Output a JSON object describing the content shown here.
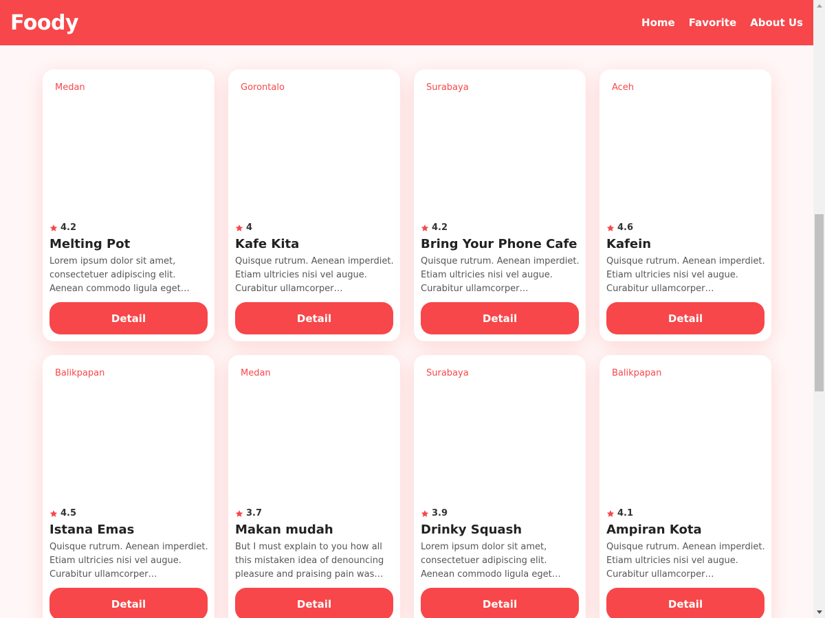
{
  "header": {
    "brand": "Foody",
    "nav": [
      {
        "label": "Home"
      },
      {
        "label": "Favorite"
      },
      {
        "label": "About Us"
      }
    ]
  },
  "theme": {
    "accent": "#f7474a"
  },
  "restaurants": [
    {
      "city": "Medan",
      "rating": "4.2",
      "name": "Melting Pot",
      "description": "Lorem ipsum dolor sit amet, consectetuer adipiscing elit. Aenean commodo ligula eget…",
      "button": "Detail"
    },
    {
      "city": "Gorontalo",
      "rating": "4",
      "name": "Kafe Kita",
      "description": "Quisque rutrum. Aenean imperdiet. Etiam ultricies nisi vel augue. Curabitur ullamcorper…",
      "button": "Detail"
    },
    {
      "city": "Surabaya",
      "rating": "4.2",
      "name": "Bring Your Phone Cafe",
      "description": "Quisque rutrum. Aenean imperdiet. Etiam ultricies nisi vel augue. Curabitur ullamcorper…",
      "button": "Detail"
    },
    {
      "city": "Aceh",
      "rating": "4.6",
      "name": "Kafein",
      "description": "Quisque rutrum. Aenean imperdiet. Etiam ultricies nisi vel augue. Curabitur ullamcorper…",
      "button": "Detail"
    },
    {
      "city": "Balikpapan",
      "rating": "4.5",
      "name": "Istana Emas",
      "description": "Quisque rutrum. Aenean imperdiet. Etiam ultricies nisi vel augue. Curabitur ullamcorper…",
      "button": "Detail"
    },
    {
      "city": "Medan",
      "rating": "3.7",
      "name": "Makan mudah",
      "description": "But I must explain to you how all this mistaken idea of denouncing pleasure and praising pain was…",
      "button": "Detail"
    },
    {
      "city": "Surabaya",
      "rating": "3.9",
      "name": "Drinky Squash",
      "description": "Lorem ipsum dolor sit amet, consectetuer adipiscing elit. Aenean commodo ligula eget…",
      "button": "Detail"
    },
    {
      "city": "Balikpapan",
      "rating": "4.1",
      "name": "Ampiran Kota",
      "description": "Quisque rutrum. Aenean imperdiet. Etiam ultricies nisi vel augue. Curabitur ullamcorper…",
      "button": "Detail"
    }
  ],
  "icons": {
    "rating": "star-icon"
  }
}
